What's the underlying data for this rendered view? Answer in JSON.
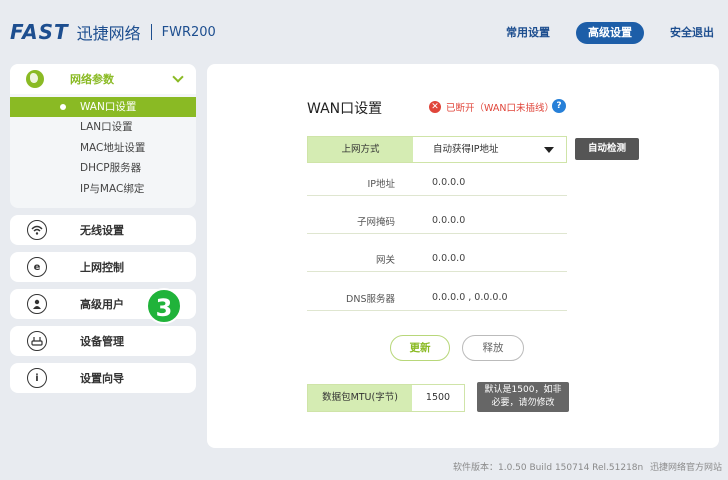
{
  "brand": {
    "logo": "FAST",
    "name_cn": "迅捷网络",
    "model": "FWR200",
    "color": "#1d4e8f"
  },
  "topnav": {
    "common": "常用设置",
    "advanced": "高级设置",
    "security": "安全退出"
  },
  "sidebar": {
    "group": {
      "label": "网络参数",
      "items": [
        "WAN口设置",
        "LAN口设置",
        "MAC地址设置",
        "DHCP服务器",
        "IP与MAC绑定"
      ]
    },
    "items": [
      {
        "label": "无线设置",
        "icon": "wifi-icon"
      },
      {
        "label": "上网控制",
        "icon": "e-icon"
      },
      {
        "label": "高级用户",
        "icon": "user-icon"
      },
      {
        "label": "设备管理",
        "icon": "router-icon"
      },
      {
        "label": "设置向导",
        "icon": "info-icon"
      }
    ],
    "badge": "3"
  },
  "main": {
    "title": "WAN口设置",
    "status": "已断开（WAN口未插线）",
    "connection": {
      "label": "上网方式",
      "value": "自动获得IP地址"
    },
    "auto_detect": "自动检测",
    "fields": [
      {
        "label": "IP地址",
        "value": "0.0.0.0"
      },
      {
        "label": "子网掩码",
        "value": "0.0.0.0"
      },
      {
        "label": "网关",
        "value": "0.0.0.0"
      },
      {
        "label": "DNS服务器",
        "value": "0.0.0.0 , 0.0.0.0"
      }
    ],
    "update": "更新",
    "release": "释放",
    "mtu": {
      "label": "数据包MTU(字节)",
      "value": "1500",
      "tip": "默认是1500，如非必要，请勿修改"
    }
  },
  "footer": {
    "version": "软件版本：1.0.50 Build 150714 Rel.51218n",
    "site": "迅捷网络官方网站"
  },
  "colors": {
    "accent": "#8aba24",
    "danger": "#e0453a",
    "primary": "#1d5ea8"
  }
}
